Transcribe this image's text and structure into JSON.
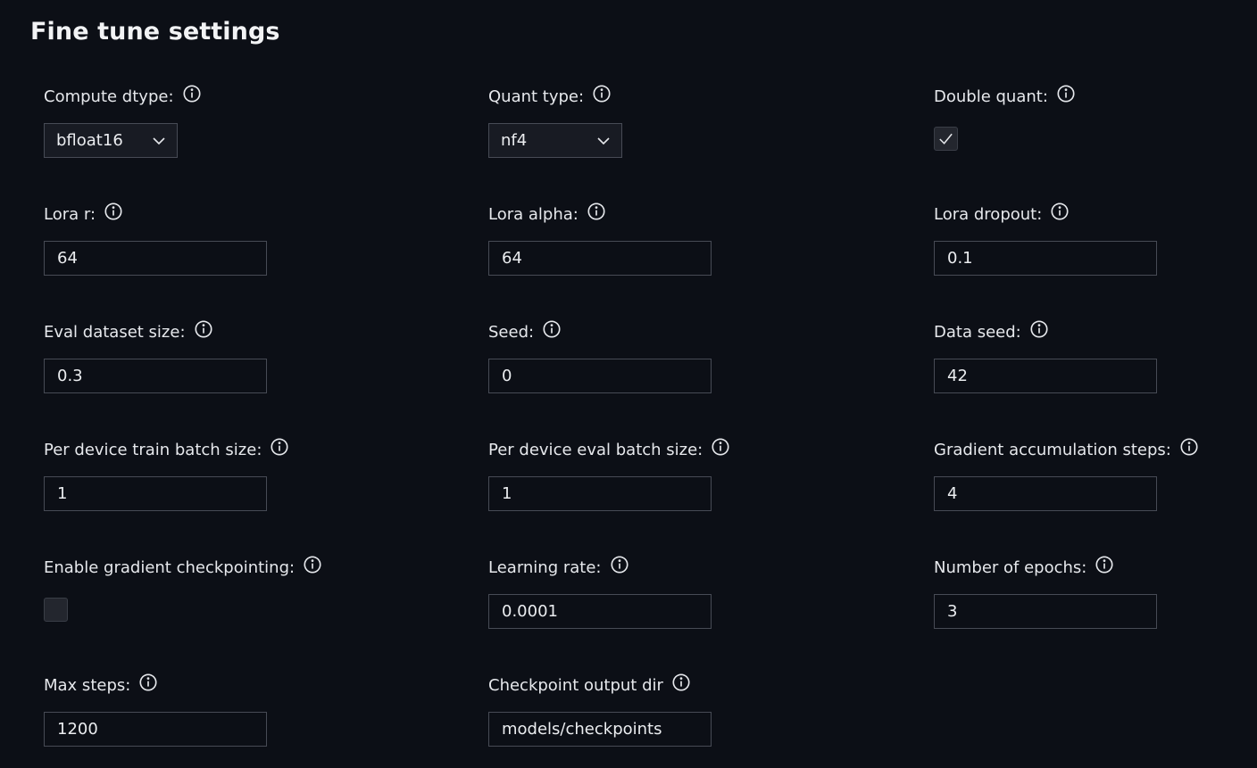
{
  "page": {
    "title": "Fine tune settings"
  },
  "colors": {
    "background": "#0c0f16",
    "input_border": "#474b55",
    "checkbox_fill": "#23262e",
    "text": "#e6e8ec"
  },
  "fields": {
    "compute_dtype": {
      "label": "Compute dtype:",
      "value": "bfloat16",
      "icon": "info-icon",
      "type": "select"
    },
    "quant_type": {
      "label": "Quant type:",
      "value": "nf4",
      "icon": "info-icon",
      "type": "select"
    },
    "double_quant": {
      "label": "Double quant:",
      "checked": true,
      "icon": "info-icon",
      "type": "checkbox"
    },
    "lora_r": {
      "label": "Lora r:",
      "value": "64",
      "icon": "info-icon"
    },
    "lora_alpha": {
      "label": "Lora alpha:",
      "value": "64",
      "icon": "info-icon"
    },
    "lora_dropout": {
      "label": "Lora dropout:",
      "value": "0.1",
      "icon": "info-icon"
    },
    "eval_dataset_size": {
      "label": "Eval dataset size:",
      "value": "0.3",
      "icon": "info-icon"
    },
    "seed": {
      "label": "Seed:",
      "value": "0",
      "icon": "info-icon"
    },
    "data_seed": {
      "label": "Data seed:",
      "value": "42",
      "icon": "info-icon"
    },
    "per_device_train_batch_size": {
      "label": "Per device train batch size:",
      "value": "1",
      "icon": "info-icon"
    },
    "per_device_eval_batch_size": {
      "label": "Per device eval batch size:",
      "value": "1",
      "icon": "info-icon"
    },
    "gradient_accumulation_steps": {
      "label": "Gradient accumulation steps:",
      "value": "4",
      "icon": "info-icon"
    },
    "enable_gradient_checkpointing": {
      "label": "Enable gradient checkpointing:",
      "checked": false,
      "icon": "info-icon",
      "type": "checkbox"
    },
    "learning_rate": {
      "label": "Learning rate:",
      "value": "0.0001",
      "icon": "info-icon"
    },
    "number_of_epochs": {
      "label": "Number of epochs:",
      "value": "3",
      "icon": "info-icon"
    },
    "max_steps": {
      "label": "Max steps:",
      "value": "1200",
      "icon": "info-icon"
    },
    "checkpoint_output_dir": {
      "label": "Checkpoint output dir",
      "value": "models/checkpoints",
      "icon": "info-icon"
    }
  }
}
